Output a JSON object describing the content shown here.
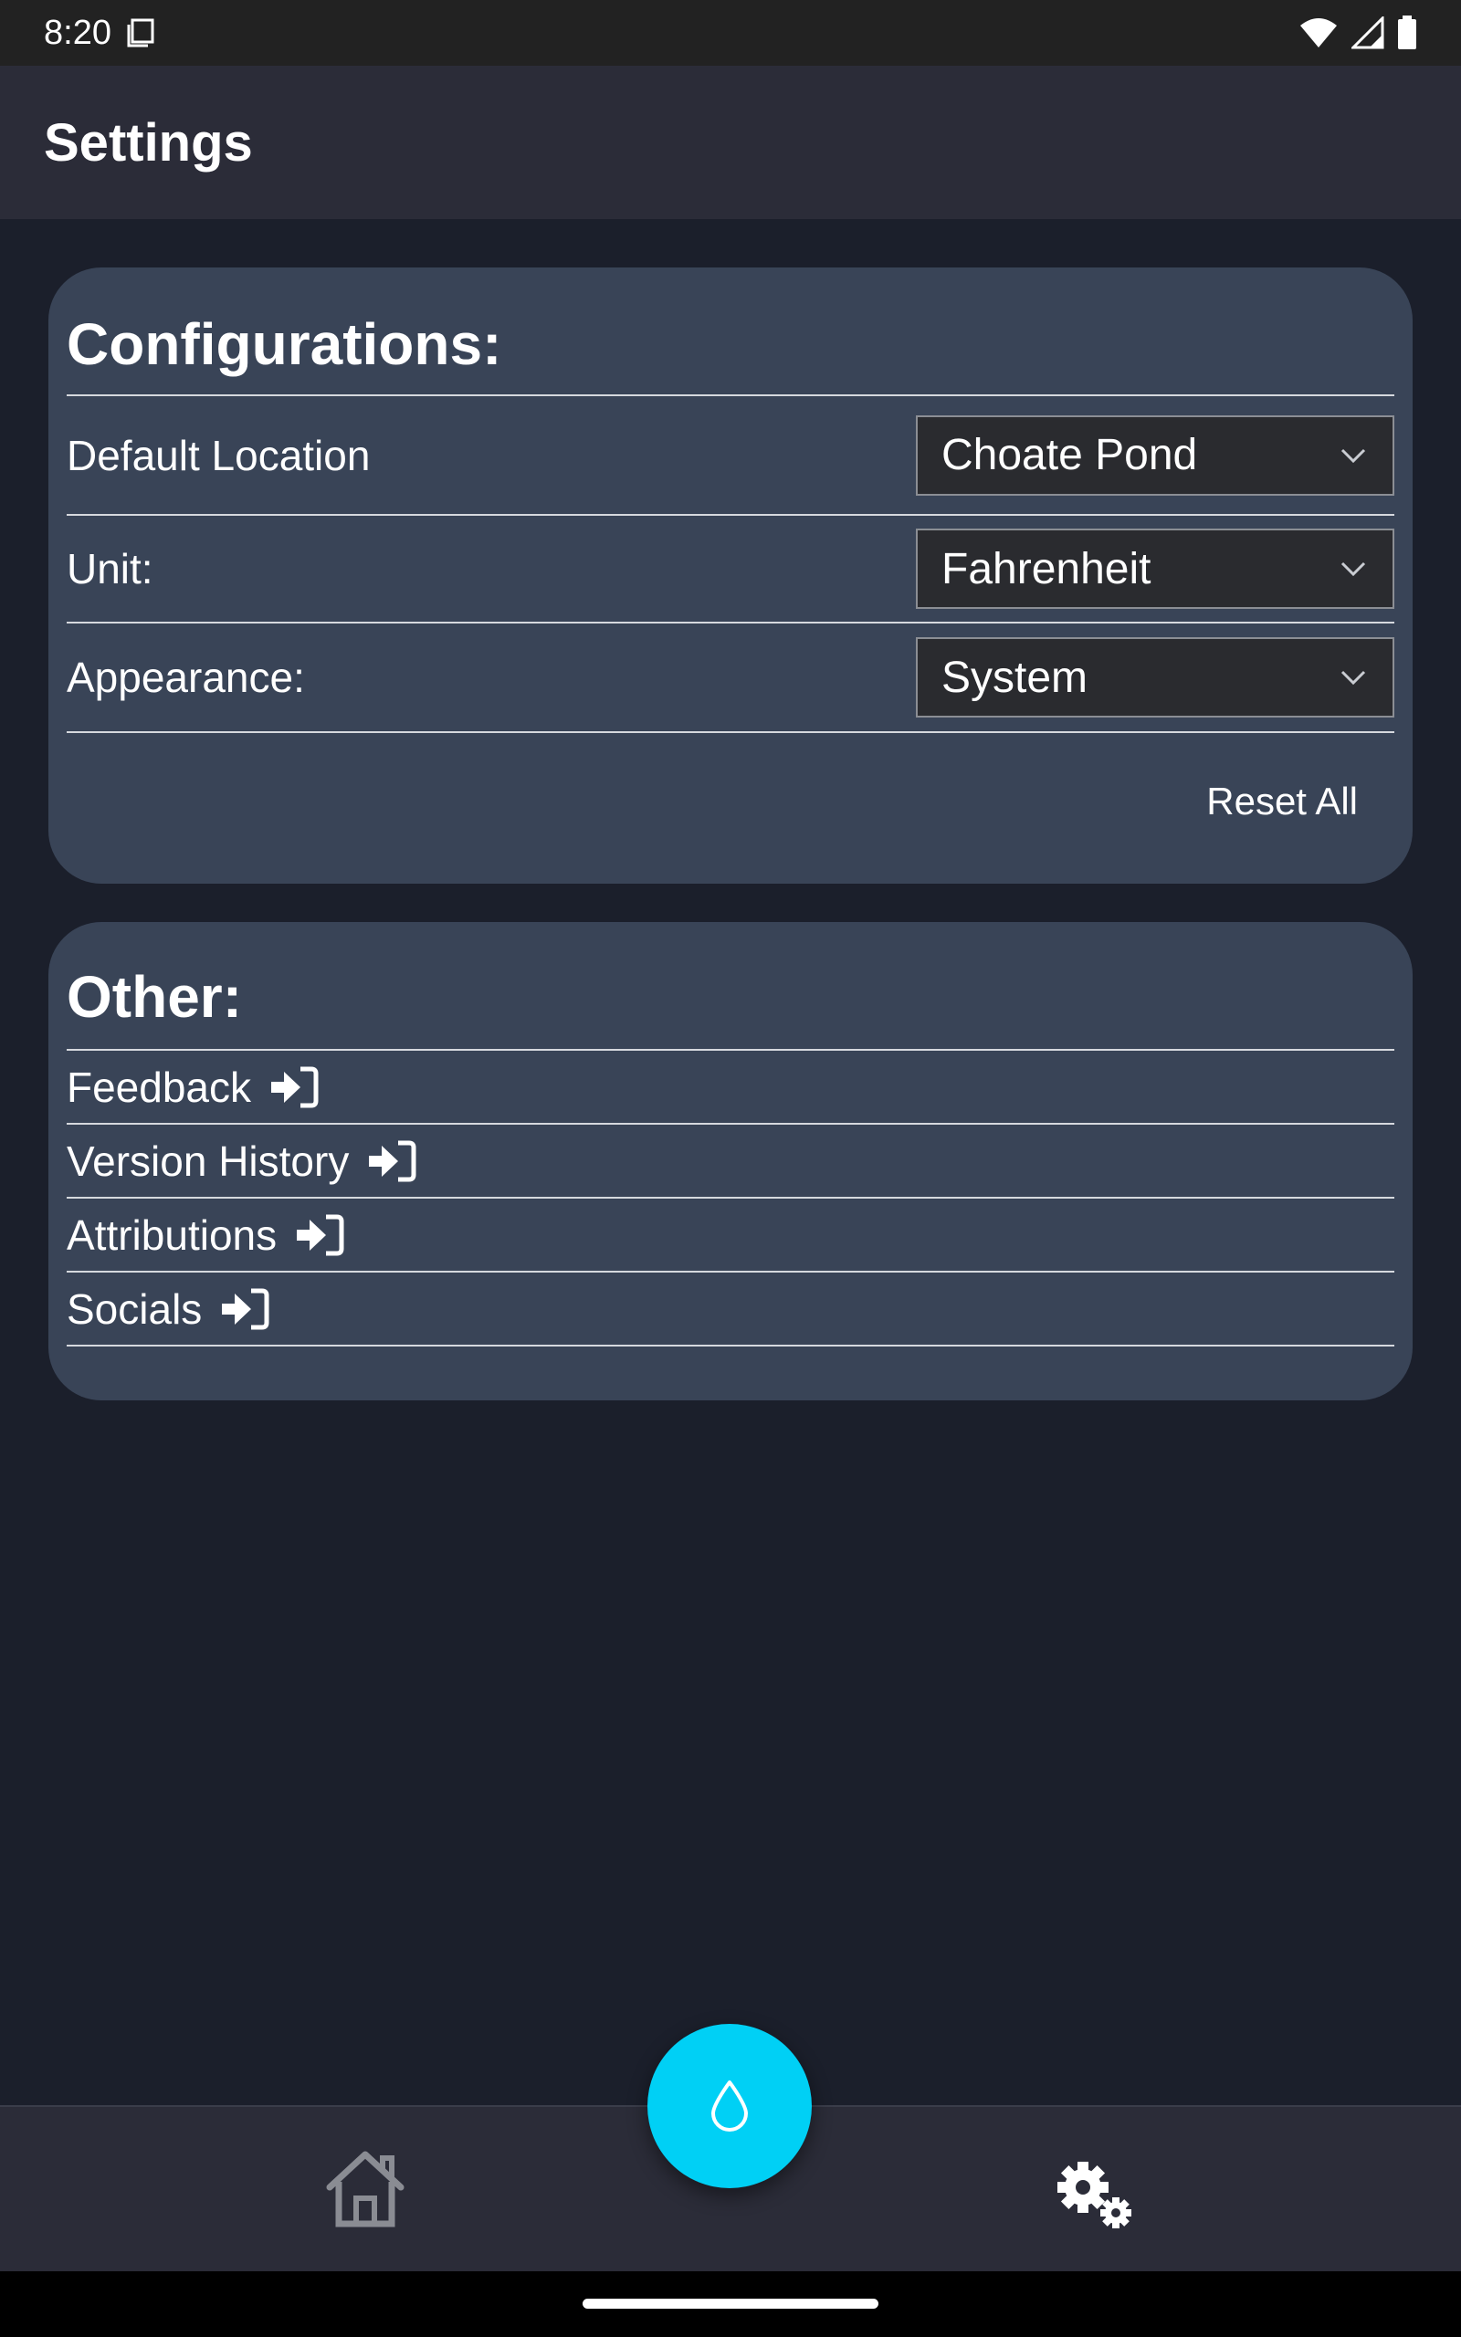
{
  "status_bar": {
    "time": "8:20",
    "icons": [
      "screenshot-icon",
      "wifi-icon",
      "signal-icon",
      "battery-icon"
    ]
  },
  "app_bar": {
    "title": "Settings"
  },
  "configurations": {
    "heading": "Configurations:",
    "rows": [
      {
        "label": "Default Location",
        "value": "Choate Pond"
      },
      {
        "label": "Unit:",
        "value": "Fahrenheit"
      },
      {
        "label": "Appearance:",
        "value": "System"
      }
    ],
    "reset_label": "Reset All"
  },
  "other": {
    "heading": "Other:",
    "links": [
      {
        "label": "Feedback"
      },
      {
        "label": "Version History"
      },
      {
        "label": "Attributions"
      },
      {
        "label": "Socials"
      }
    ]
  },
  "bottom_nav": {
    "items": [
      "home-icon",
      "water-drop-icon",
      "gears-icon"
    ]
  },
  "colors": {
    "background": "#1b1f2b",
    "card": "#394457",
    "app_bar": "#2b2c38",
    "fab": "#00d0f5",
    "select_bg": "#2a2b2f"
  }
}
